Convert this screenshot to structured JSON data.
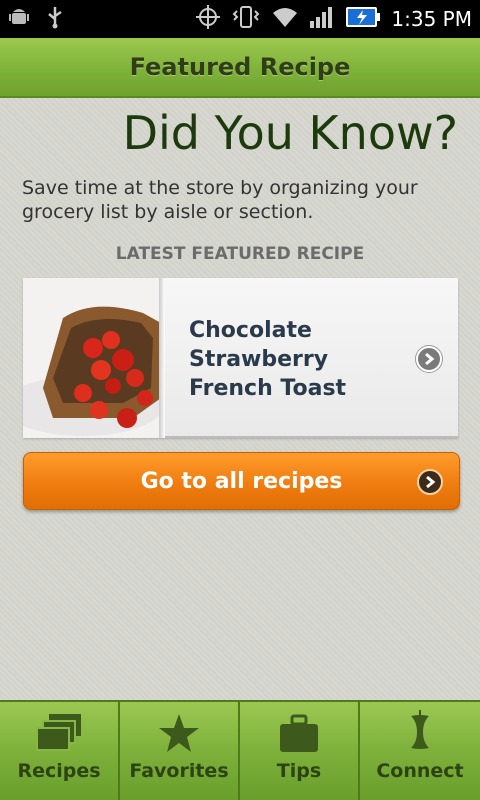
{
  "status_bar": {
    "time": "1:35 PM",
    "icons": [
      "android-debug-icon",
      "usb-icon",
      "gps-icon",
      "vibrate-icon",
      "wifi-icon",
      "signal-icon",
      "battery-charging-icon"
    ]
  },
  "header": {
    "title": "Featured Recipe"
  },
  "did_you_know": {
    "heading": "Did You Know?",
    "tip": "Save time at the store by organizing your grocery list by aisle or section."
  },
  "featured": {
    "section_label": "LATEST FEATURED RECIPE",
    "recipe_name": "Chocolate Strawberry French Toast",
    "image_icon": "french-toast-photo"
  },
  "all_recipes_button": {
    "label": "Go to all recipes"
  },
  "tabs": [
    {
      "label": "Recipes",
      "icon": "stacked-cards-icon"
    },
    {
      "label": "Favorites",
      "icon": "star-icon"
    },
    {
      "label": "Tips",
      "icon": "briefcase-icon"
    },
    {
      "label": "Connect",
      "icon": "apple-core-icon"
    }
  ],
  "colors": {
    "header_green": "#7fb23a",
    "heading_dark_green": "#1d3a0c",
    "button_orange": "#f07d10",
    "tab_text": "#2e4313"
  }
}
